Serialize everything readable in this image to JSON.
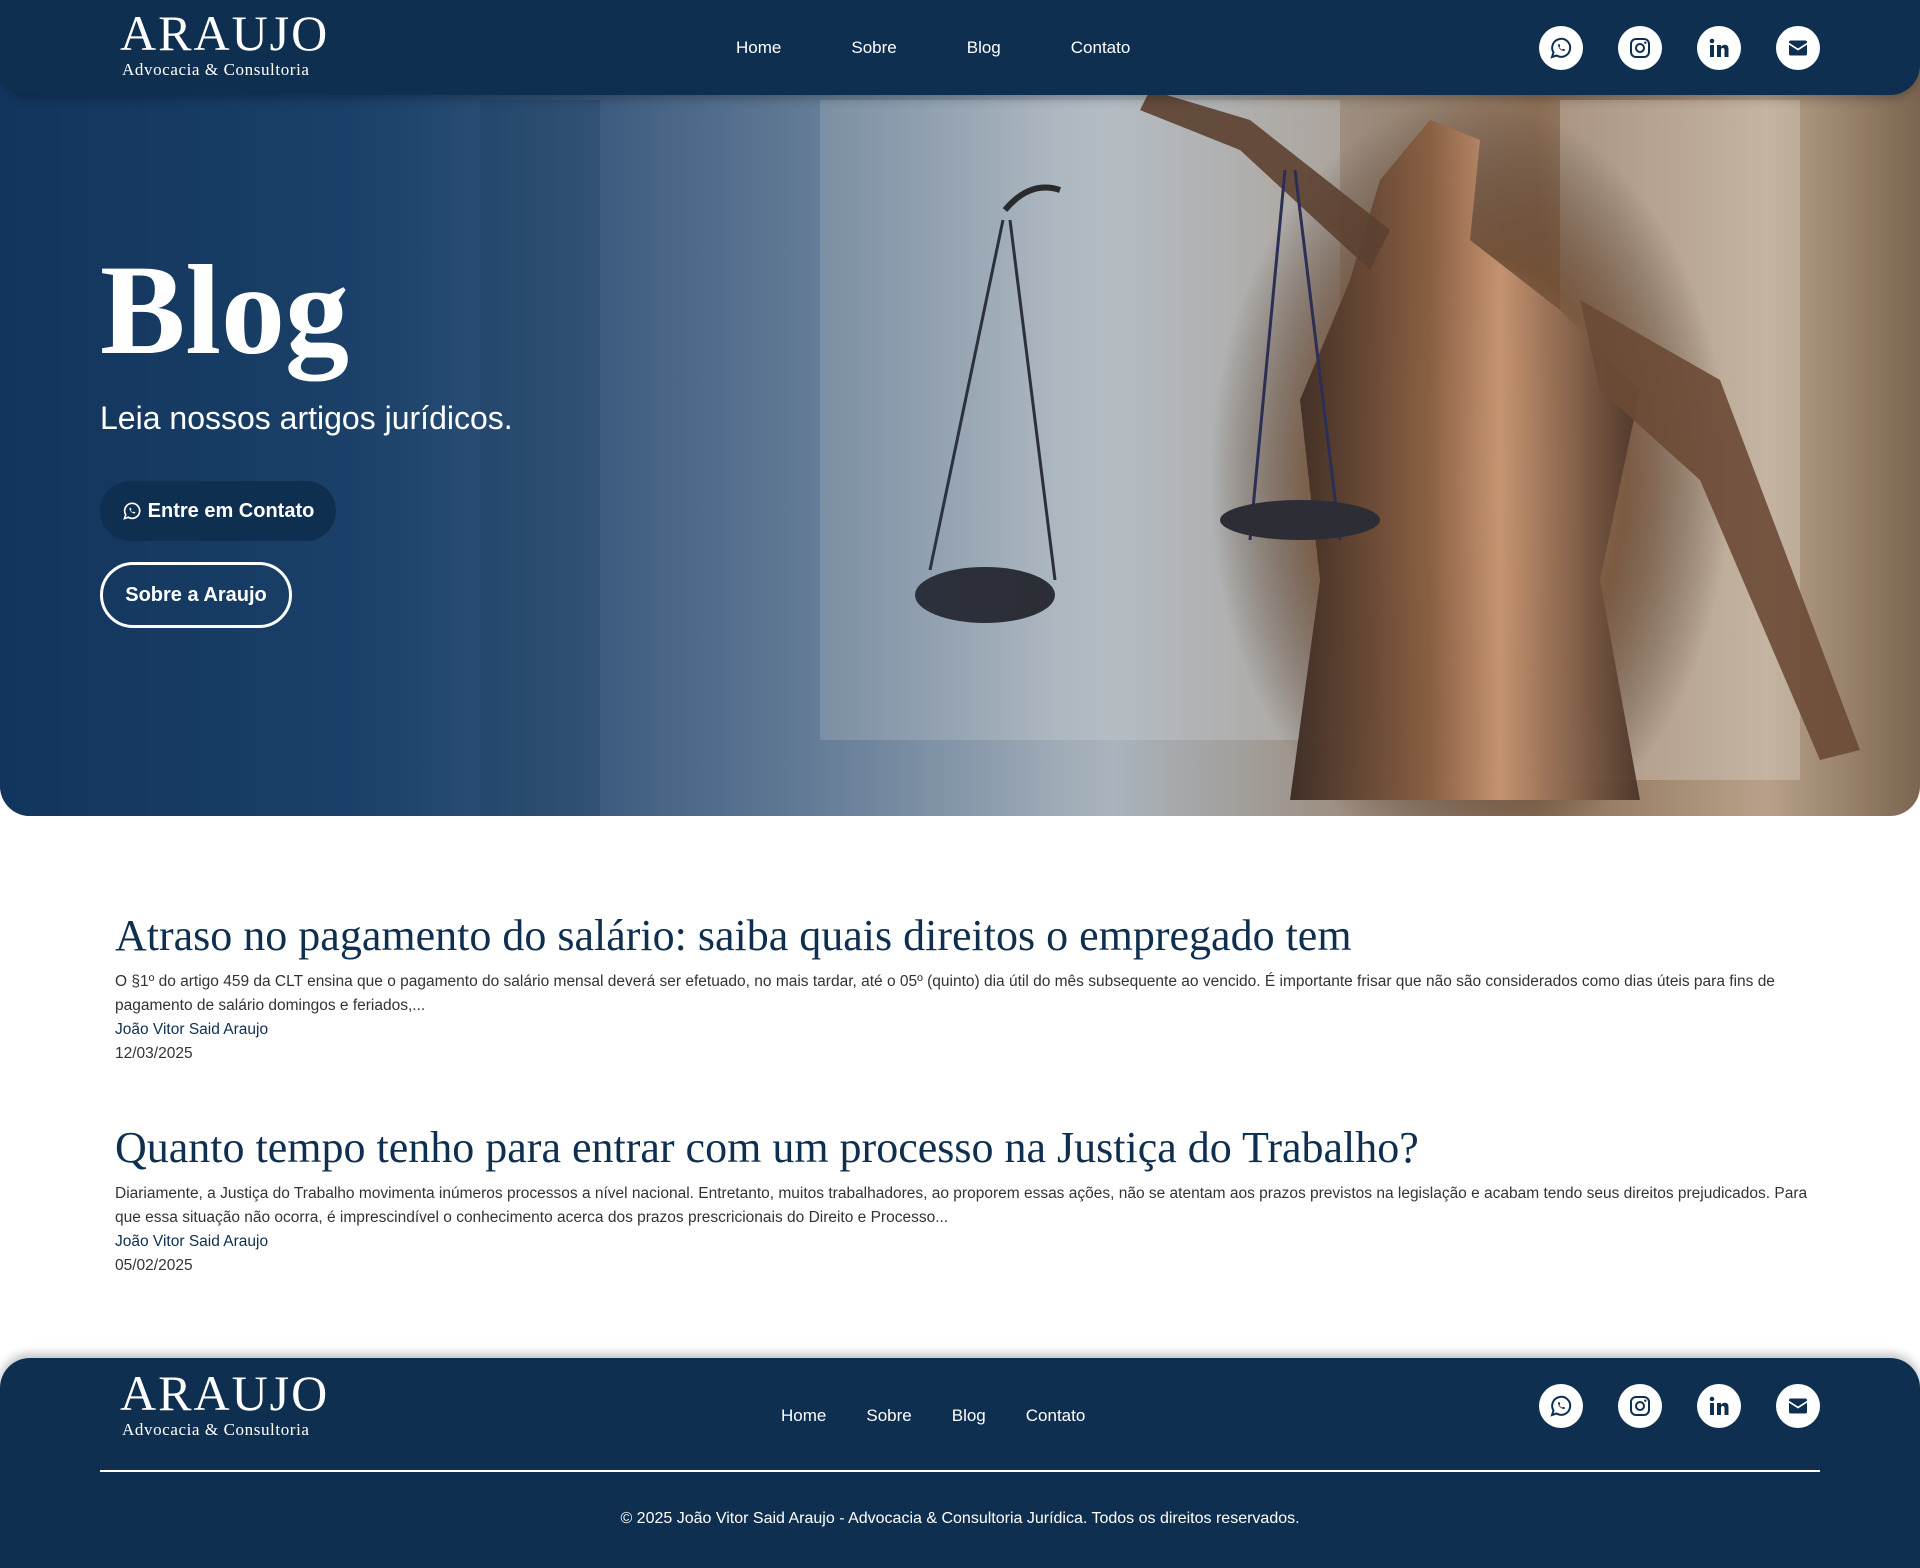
{
  "brand": {
    "name": "ARAUJO",
    "tagline": "Advocacia & Consultoria"
  },
  "nav": {
    "items": [
      "Home",
      "Sobre",
      "Blog",
      "Contato"
    ]
  },
  "socials": [
    "whatsapp-icon",
    "instagram-icon",
    "linkedin-icon",
    "envelope-icon"
  ],
  "hero": {
    "title": "Blog",
    "subtitle": "Leia nossos artigos jurídicos.",
    "contact_button": "Entre em Contato",
    "about_button": "Sobre a Araujo"
  },
  "posts": [
    {
      "title": "Atraso no pagamento do salário: saiba quais direitos o empregado tem",
      "excerpt": "O §1º do artigo 459 da CLT ensina que o pagamento do salário mensal deverá ser efetuado, no mais tardar, até o 05º (quinto) dia útil do mês subsequente ao vencido. É importante frisar que não são considerados como dias úteis para fins de pagamento de salário domingos e feriados,...",
      "author": "João Vitor Said Araujo",
      "date": "12/03/2025"
    },
    {
      "title": "Quanto tempo tenho para entrar com um processo na Justiça do Trabalho?",
      "excerpt": "Diariamente, a Justiça do Trabalho movimenta inúmeros processos a nível nacional. Entretanto, muitos trabalhadores, ao proporem essas ações, não se atentam aos prazos previstos na legislação e acabam tendo seus direitos prejudicados. Para que essa situação não ocorra, é imprescindível o conhecimento acerca dos prazos prescricionais do Direito e Processo...",
      "author": "João Vitor Said Araujo",
      "date": "05/02/2025"
    }
  ],
  "footer": {
    "copyright": "© 2025 João Vitor Said Araujo - Advocacia & Consultoria Jurídica. Todos os direitos reservados."
  },
  "colors": {
    "primary": "#0f2f50",
    "text": "#333333",
    "background": "#ffffff"
  }
}
